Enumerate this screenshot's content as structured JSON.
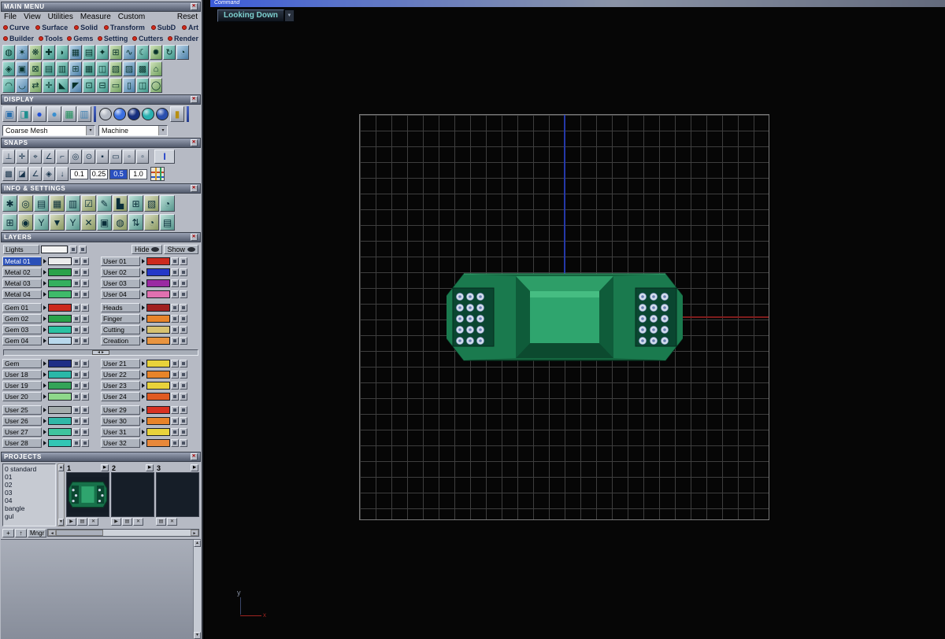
{
  "glyphs": {
    "close": "✕",
    "dropdown": "▾",
    "left": "◄",
    "right": "►",
    "up": "▲",
    "down": "▼",
    "play": "▶",
    "save": "▤",
    "del": "✕"
  },
  "panel": {
    "main_menu": {
      "title": "MAIN MENU",
      "menu": [
        "File",
        "View",
        "Utilities",
        "Measure",
        "Custom"
      ],
      "reset": "Reset",
      "cats1": [
        "Curve",
        "Surface",
        "Solid",
        "Transform",
        "SubD",
        "Art"
      ],
      "cats2": [
        "Builder",
        "Tools",
        "Gems",
        "Setting",
        "Cutters",
        "Render"
      ],
      "icons1": [
        "◍",
        "✶",
        "❋",
        "✚",
        "◗",
        "▦",
        "▤",
        "✦",
        "⊞",
        "∿",
        "☾",
        "✹",
        "↻",
        "◔"
      ],
      "icons2": [
        "◈",
        "▣",
        "⊠",
        "▤",
        "▥",
        "⊞",
        "▦",
        "◫",
        "▧",
        "▨",
        "▩",
        "⌂"
      ],
      "icons3": [
        "◠",
        "◡",
        "⇄",
        "✛",
        "◣",
        "◤",
        "⊡",
        "⊟",
        "▭",
        "▯",
        "◫",
        "◯"
      ]
    },
    "display": {
      "title": "DISPLAY",
      "icons": [
        {
          "g": "▣",
          "c": "#2a6fae"
        },
        {
          "g": "◨",
          "c": "#1e8f8f"
        },
        {
          "g": "●",
          "c": "#2050d8"
        },
        {
          "g": "●",
          "c": "#3a8fd0"
        },
        {
          "g": "▦",
          "c": "#1e8f5a"
        },
        {
          "g": "▥",
          "c": "#3a7fb0"
        }
      ],
      "spheres": [
        {
          "c": "#b4bac4"
        },
        {
          "c": "#3a6fe0"
        },
        {
          "c": "#162f7e"
        },
        {
          "c": "#28b0b0"
        },
        {
          "c": "#2a4fae"
        }
      ],
      "end_icon": {
        "g": "▮",
        "c": "#b88f10"
      },
      "mesh_dd": "Coarse Mesh",
      "machine_dd": "Machine"
    },
    "snaps": {
      "title": "SNAPS",
      "icons1": [
        "⊥",
        "✛",
        "⌖",
        "∠",
        "⌐",
        "◎",
        "⊙",
        "▪",
        "▭",
        "▫",
        "▫"
      ],
      "end_label": "I",
      "icons2": [
        "▩",
        "◪",
        "∠",
        "◈",
        "↓"
      ],
      "values": [
        {
          "v": "0.1"
        },
        {
          "v": "0.25"
        },
        {
          "v": "0.5",
          "bg": "#2a50c0",
          "fg": "#ffffff"
        },
        {
          "v": "1.0"
        }
      ]
    },
    "info": {
      "title": "INFO & SETTINGS",
      "icons1": [
        "✱",
        "◎",
        "▤",
        "▦",
        "▥",
        "☑",
        "✎",
        "▙",
        "⊞",
        "▧",
        "◔"
      ],
      "icons2": [
        "⊞",
        "◉",
        "Y",
        "▼",
        "Y",
        "✕",
        "▣",
        "◍",
        "⇅",
        "◔",
        "▤"
      ]
    },
    "layers": {
      "title": "LAYERS",
      "lights": "Lights",
      "lights_color": "#f4f4f4",
      "hide": "Hide",
      "show": "Show",
      "g1": [
        {
          "l": "Metal 01",
          "lc": "#ececec",
          "lbg": "#2a50b8",
          "lfg": "#ffffff",
          "r": "User 01",
          "rc": "#cc2a1e"
        },
        {
          "l": "Metal 02",
          "lc": "#2aa24a",
          "r": "User 02",
          "rc": "#2438c8"
        },
        {
          "l": "Metal 03",
          "lc": "#34b05e",
          "r": "User 03",
          "rc": "#9a2aa2"
        },
        {
          "l": "Metal 04",
          "lc": "#3eba6a",
          "r": "User 04",
          "rc": "#e070b0"
        }
      ],
      "g2": [
        {
          "l": "Gem 01",
          "lc": "#cc2a1e",
          "r": "Heads",
          "rc": "#a02020"
        },
        {
          "l": "Gem 02",
          "lc": "#2aa24a",
          "r": "Finger",
          "rc": "#e8842a"
        },
        {
          "l": "Gem 03",
          "lc": "#2ac2a2",
          "r": "Cutting",
          "rc": "#d8c270"
        },
        {
          "l": "Gem 04",
          "lc": "#b8d8ec",
          "r": "Creation",
          "rc": "#e89440"
        }
      ],
      "g3": [
        {
          "l": "Gem",
          "lc": "#1e2e86",
          "r": "User 21",
          "rc": "#e8d23a"
        },
        {
          "l": "User 18",
          "lc": "#2ab8a8",
          "r": "User 22",
          "rc": "#e8842a"
        },
        {
          "l": "User 19",
          "lc": "#34a458",
          "r": "User 23",
          "rc": "#e8d23a"
        },
        {
          "l": "User 20",
          "lc": "#8ed88a",
          "r": "User 24",
          "rc": "#e05a22"
        }
      ],
      "g4": [
        {
          "l": "User 25",
          "lc": "#a4acac",
          "r": "User 29",
          "rc": "#d83222"
        },
        {
          "l": "User 26",
          "lc": "#30b8a8",
          "r": "User 30",
          "rc": "#e8842a"
        },
        {
          "l": "User 27",
          "lc": "#3ec49e",
          "r": "User 31",
          "rc": "#e8d23a"
        },
        {
          "l": "User 28",
          "lc": "#32c6b4",
          "r": "User 32",
          "rc": "#e8883a"
        }
      ]
    },
    "projects": {
      "title": "PROJECTS",
      "files": [
        "0 standard",
        "01",
        "02",
        "03",
        "04",
        "bangle",
        "gul"
      ],
      "slots": [
        {
          "num": "1"
        },
        {
          "num": "2"
        },
        {
          "num": "3"
        }
      ],
      "bottom": [
        "+",
        "↑",
        "Mngr"
      ]
    }
  },
  "viewport": {
    "title_fragment": "Command",
    "view_label": "Looking Down",
    "axis_x": "x",
    "axis_y": "y",
    "gem_cols": 3,
    "gem_rows": 5
  }
}
